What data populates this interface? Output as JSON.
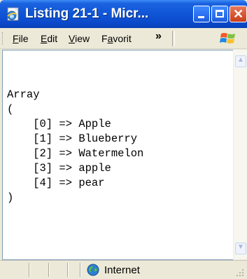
{
  "window": {
    "title": "Listing 21-1 - Micr...",
    "icons": {
      "app": "ie-page-icon",
      "minimize": "minimize-icon",
      "maximize": "maximize-icon",
      "close": "close-icon"
    }
  },
  "menu": {
    "items": [
      {
        "mnemonic": "F",
        "rest": "ile"
      },
      {
        "mnemonic": "E",
        "rest": "dit"
      },
      {
        "mnemonic": "V",
        "rest": "iew"
      },
      {
        "pre": "F",
        "mnemonic": "a",
        "rest": "vorit"
      }
    ],
    "overflow": "»",
    "logo": "windows-flag-logo"
  },
  "content": {
    "lines": [
      "Array",
      "(",
      "    [0] => Apple",
      "    [1] => Blueberry",
      "    [2] => Watermelon",
      "    [3] => apple",
      "    [4] => pear",
      ")"
    ]
  },
  "statusbar": {
    "zone": "Internet",
    "zone_icon": "internet-globe-icon"
  },
  "colors": {
    "titlebar": "#0f55d6",
    "chrome": "#ece9d8",
    "close_button": "#d8532f"
  }
}
